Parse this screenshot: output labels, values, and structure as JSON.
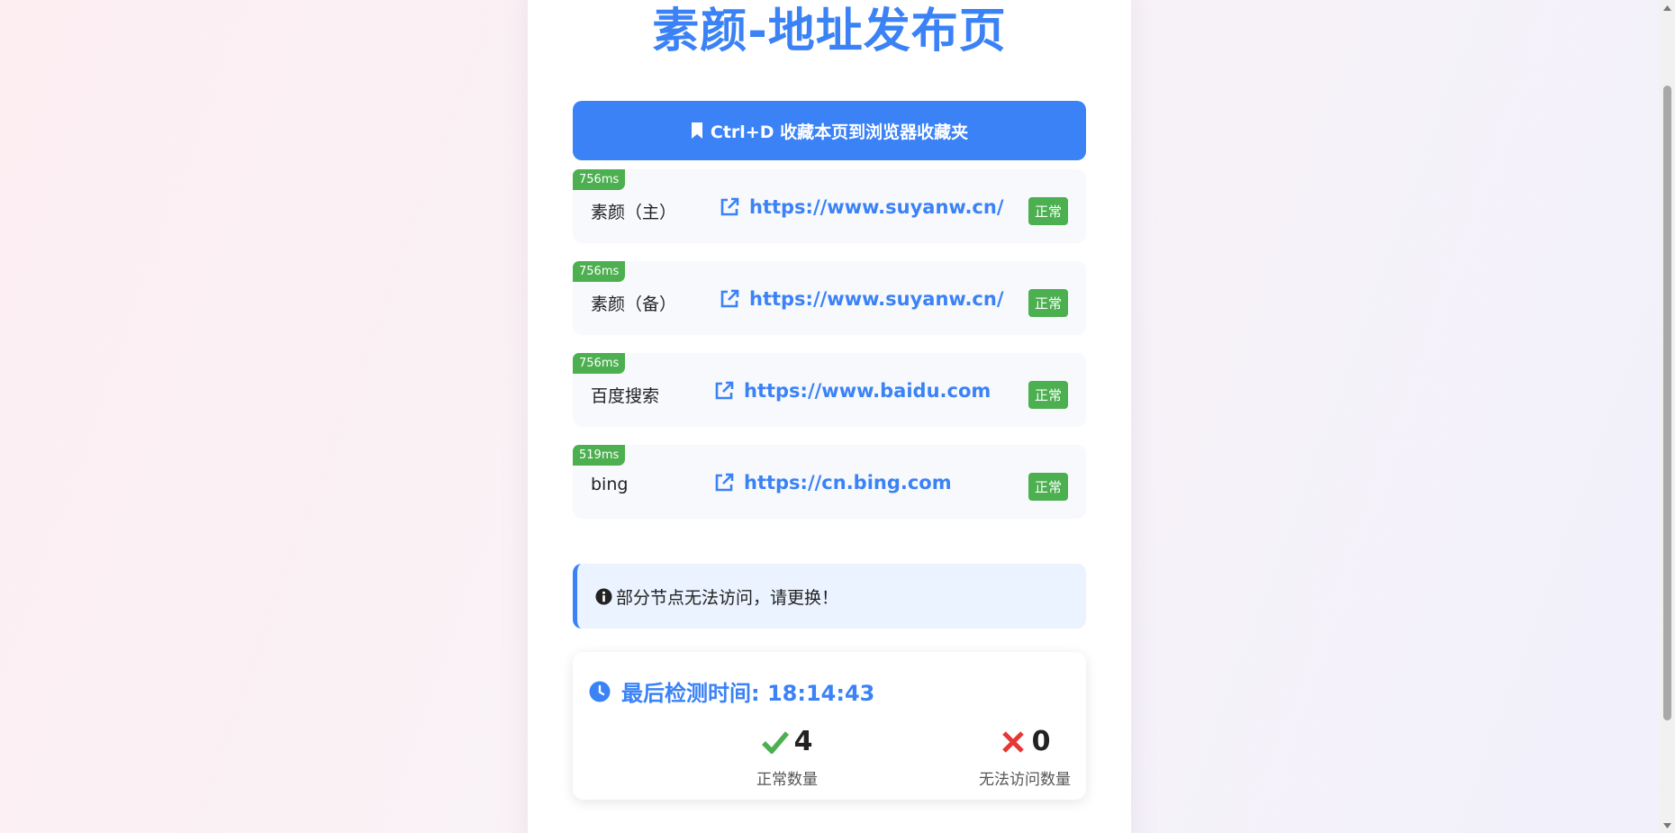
{
  "page": {
    "title": "素颜-地址发布页",
    "bookmark_label": "Ctrl+D 收藏本页到浏览器收藏夹"
  },
  "sites": [
    {
      "latency": "756ms",
      "name": "素颜（主）",
      "url": "https://www.suyanw.cn/",
      "status": "正常"
    },
    {
      "latency": "756ms",
      "name": "素颜（备）",
      "url": "https://www.suyanw.cn/",
      "status": "正常"
    },
    {
      "latency": "756ms",
      "name": "百度搜索",
      "url": "https://www.baidu.com",
      "status": "正常"
    },
    {
      "latency": "519ms",
      "name": "bing",
      "url": "https://cn.bing.com",
      "status": "正常"
    }
  ],
  "notice": "部分节点无法访问，请更换！",
  "stats": {
    "last_check": "最后检测时间: 18:14:43",
    "ok_count": "4",
    "ok_label": "正常数量",
    "fail_count": "0",
    "fail_label": "无法访问数量"
  },
  "colors": {
    "accent": "#3b82f6",
    "ok": "#4caf50",
    "fail": "#e53935"
  }
}
